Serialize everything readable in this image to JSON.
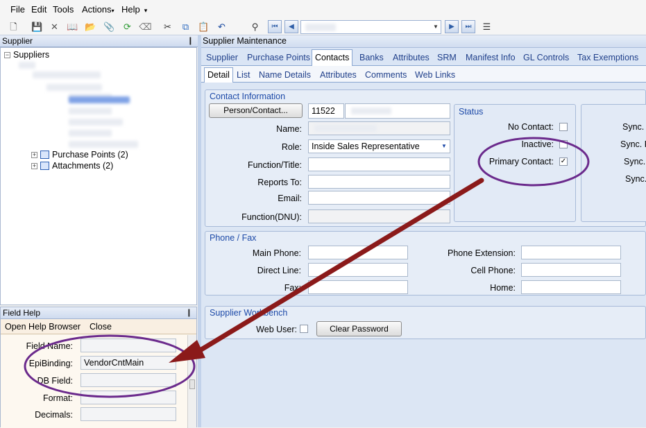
{
  "menubar": {
    "items": [
      "File",
      "Edit",
      "Tools",
      "Actions",
      "Help"
    ]
  },
  "supplier_panel": {
    "title": "Supplier",
    "pin": "❙"
  },
  "tree": {
    "root": "Suppliers",
    "purchase_points": "Purchase Points (2)",
    "attachments": "Attachments (2)"
  },
  "field_help": {
    "title": "Field Help",
    "open_browser": "Open Help Browser",
    "close": "Close",
    "labels": {
      "field_name": "Field Name:",
      "epibinding": "EpiBinding:",
      "db_field": "DB Field:",
      "format": "Format:",
      "decimals": "Decimals:"
    },
    "values": {
      "field_name": "",
      "epibinding": "VendorCntMain",
      "db_field": "",
      "format": "",
      "decimals": ""
    }
  },
  "supplier_maintenance": {
    "title": "Supplier Maintenance",
    "main_tabs": [
      "Supplier",
      "Purchase Points",
      "Contacts",
      "Banks",
      "Attributes",
      "SRM",
      "Manifest Info",
      "GL Controls",
      "Tax Exemptions"
    ],
    "sub_tabs": [
      "Detail",
      "List",
      "Name Details",
      "Attributes",
      "Comments",
      "Web Links"
    ]
  },
  "contact_info": {
    "title": "Contact Information",
    "person_button": "Person/Contact...",
    "contact_id": "11522",
    "labels": {
      "name": "Name:",
      "role": "Role:",
      "function_title": "Function/Title:",
      "reports_to": "Reports To:",
      "email": "Email:",
      "function_dnu": "Function(DNU):"
    },
    "role_value": "Inside Sales Representative",
    "function_title": "",
    "reports_to": "",
    "email": "",
    "function_dnu": ""
  },
  "status": {
    "title": "Status",
    "no_contact": "No Contact:",
    "inactive": "Inactive:",
    "primary_contact": "Primary Contact:",
    "no_contact_checked": false,
    "inactive_checked": false,
    "primary_contact_checked": true,
    "check_mark": "✓"
  },
  "sync": {
    "labels": [
      "Sync.",
      "Sync. F",
      "Sync.",
      "Sync."
    ]
  },
  "phone_fax": {
    "title": "Phone / Fax",
    "labels": {
      "main_phone": "Main Phone:",
      "direct_line": "Direct Line:",
      "fax": "Fax:",
      "phone_extension": "Phone Extension:",
      "cell_phone": "Cell Phone:",
      "home": "Home:"
    }
  },
  "workbench": {
    "title": "Supplier Workbench",
    "web_user": "Web User:",
    "web_user_checked": false,
    "clear_password": "Clear Password"
  },
  "colors": {
    "annotation_circle": "#6b2a8c",
    "annotation_arrow": "#8b1a1a"
  }
}
